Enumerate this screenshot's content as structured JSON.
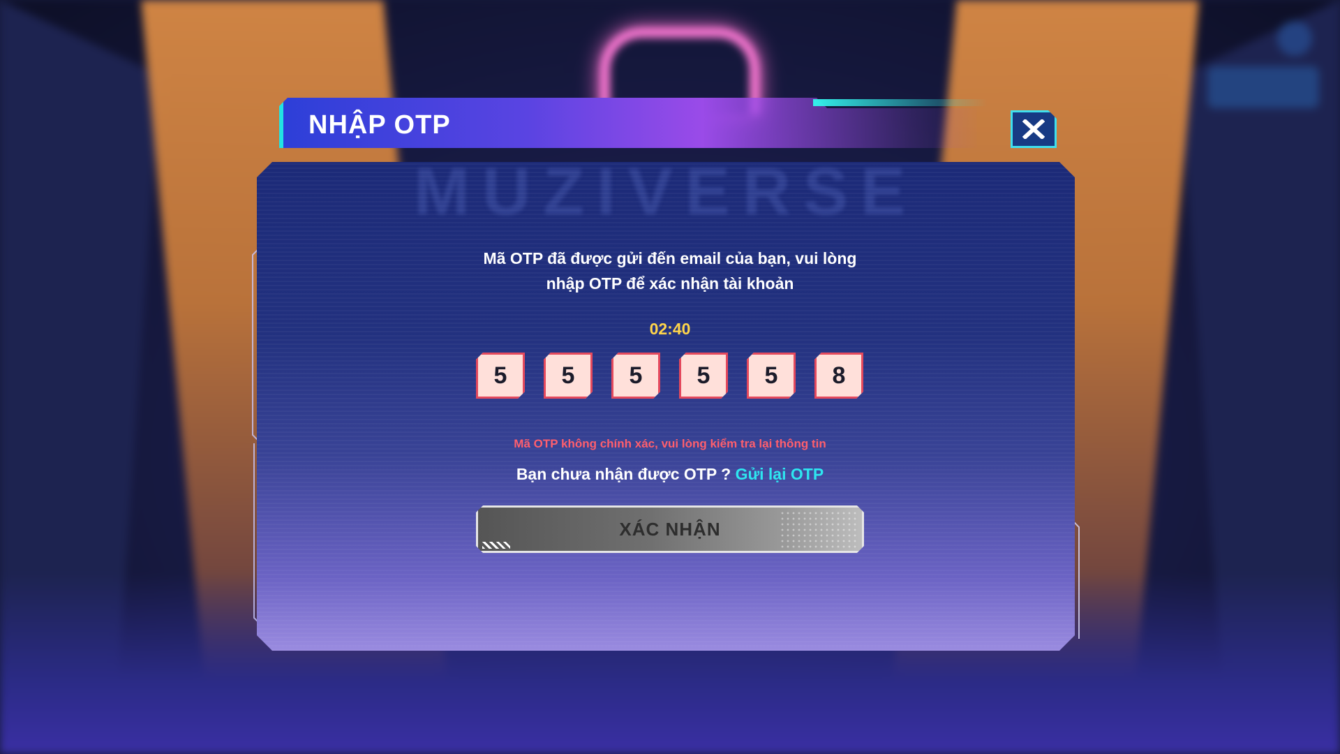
{
  "background": {
    "brand_ghost": "MUZIVERSE"
  },
  "modal": {
    "title": "NHẬP OTP",
    "close_icon": "close-icon",
    "message_line1": "Mã OTP đã được gửi đến email của bạn, vui lòng",
    "message_line2": "nhập OTP để xác nhận tài khoản",
    "timer": "02:40",
    "otp_digits": [
      "5",
      "5",
      "5",
      "5",
      "5",
      "8"
    ],
    "error_text": "Mã OTP không chính xác, vui lòng kiểm tra lại thông tin",
    "resend_prompt": "Bạn chưa nhận được OTP ? ",
    "resend_link": "Gửi lại OTP",
    "confirm_label": "XÁC NHẬN"
  },
  "colors": {
    "accent_cyan": "#22e3e3",
    "timer_yellow": "#ffd54a",
    "error_red": "#ff5f6d",
    "otp_border": "#e4495d",
    "otp_fill": "#ffe0da",
    "link_cyan": "#2ee6f0"
  }
}
